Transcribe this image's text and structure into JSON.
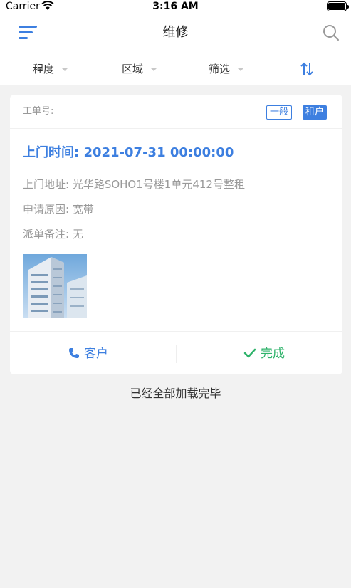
{
  "status_bar": {
    "carrier": "Carrier",
    "time": "3:16 AM"
  },
  "nav": {
    "title": "维修",
    "menu_icon": "menu-icon",
    "search_icon": "search-icon",
    "accent": "#3d7fe0"
  },
  "filters": [
    {
      "label": "程度"
    },
    {
      "label": "区域"
    },
    {
      "label": "筛选"
    }
  ],
  "sort_icon": "sort-icon",
  "card": {
    "order_no_label": "工单号:",
    "tag_level": "一般",
    "tag_tenant": "租户",
    "visit_time": "上门时间: 2021-07-31 00:00:00",
    "address": "上门地址: 光华路SOHO1号楼1单元412号整租",
    "reason": "申请原因: 宽带",
    "remark": "派单备注: 无",
    "photo": "building-photo",
    "actions": {
      "customer": "客户",
      "done": "完成"
    }
  },
  "footer_text": "已经全部加载完毕",
  "colors": {
    "primary": "#3d7fe0",
    "success": "#2fb36b",
    "background": "#f2f2f2"
  }
}
